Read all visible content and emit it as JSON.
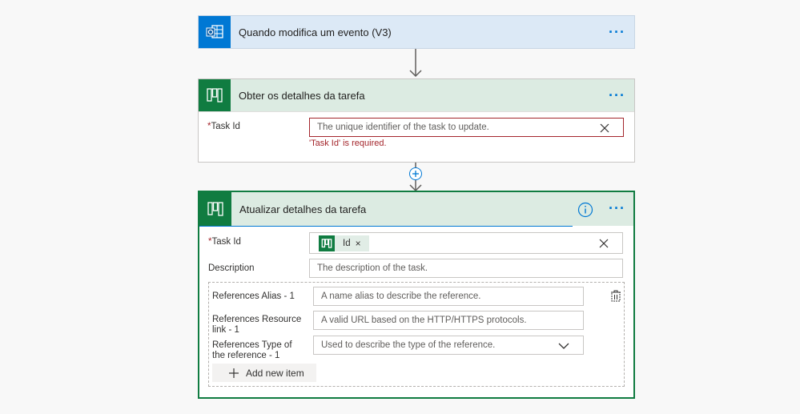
{
  "step1": {
    "title": "Quando modifica um evento (V3)",
    "more": "···"
  },
  "step2": {
    "title": "Obter os detalhes da tarefa",
    "more": "···",
    "task_id_label": "Task Id",
    "required_mark": "*",
    "task_id_placeholder": "The unique identifier of the task to update.",
    "error": "'Task Id' is required."
  },
  "step3": {
    "title": "Atualizar detalhes da tarefa",
    "more": "···",
    "info_icon": "info-icon",
    "required_mark": "*",
    "task_id_label": "Task Id",
    "task_id_token": "Id",
    "token_remove": "×",
    "description_label": "Description",
    "description_placeholder": "The description of the task.",
    "references": {
      "alias_label": "References Alias - 1",
      "alias_placeholder": "A name alias to describe the reference.",
      "resource_label": "References Resource link - 1",
      "resource_placeholder": "A valid URL based on the HTTP/HTTPS protocols.",
      "type_label": "References Type of the reference - 1",
      "type_placeholder": "Used to describe the type of the reference.",
      "add_item": "Add new item"
    }
  },
  "colors": {
    "outlook_blue": "#0078d4",
    "planner_green": "#107c41",
    "error_red": "#a4262c",
    "header_blue": "#dce9f6",
    "header_green": "#dcebe2"
  }
}
